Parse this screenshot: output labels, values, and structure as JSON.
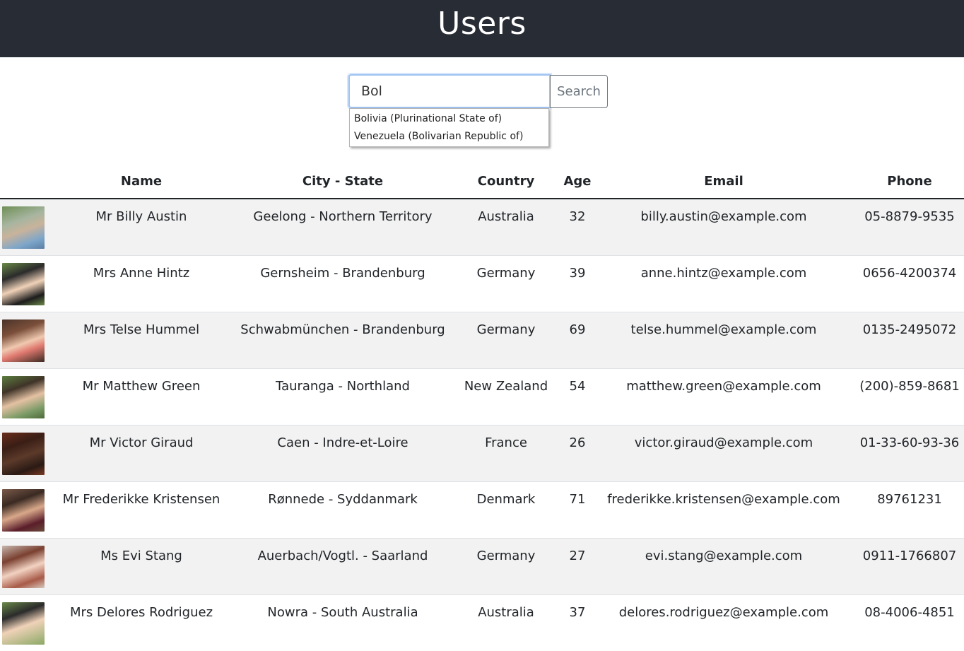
{
  "header": {
    "title": "Users"
  },
  "search": {
    "value": "Bol",
    "button_label": "Search",
    "suggestions": [
      "Bolivia (Plurinational State of)",
      "Venezuela (Bolivarian Republic of)"
    ]
  },
  "table": {
    "columns": [
      "",
      "Name",
      "City - State",
      "Country",
      "Age",
      "Email",
      "Phone"
    ],
    "rows": [
      {
        "avatar": "photo",
        "name": "Mr Billy Austin",
        "location": "Geelong - Northern Territory",
        "country": "Australia",
        "age": "32",
        "email": "billy.austin@example.com",
        "phone": "05-8879-9535"
      },
      {
        "avatar": "photo",
        "name": "Mrs Anne Hintz",
        "location": "Gernsheim - Brandenburg",
        "country": "Germany",
        "age": "39",
        "email": "anne.hintz@example.com",
        "phone": "0656-4200374"
      },
      {
        "avatar": "photo",
        "name": "Mrs Telse Hummel",
        "location": "Schwabmünchen - Brandenburg",
        "country": "Germany",
        "age": "69",
        "email": "telse.hummel@example.com",
        "phone": "0135-2495072"
      },
      {
        "avatar": "photo",
        "name": "Mr Matthew Green",
        "location": "Tauranga - Northland",
        "country": "New Zealand",
        "age": "54",
        "email": "matthew.green@example.com",
        "phone": "(200)-859-8681"
      },
      {
        "avatar": "photo",
        "name": "Mr Victor Giraud",
        "location": "Caen - Indre-et-Loire",
        "country": "France",
        "age": "26",
        "email": "victor.giraud@example.com",
        "phone": "01-33-60-93-36"
      },
      {
        "avatar": "photo",
        "name": "Mr Frederikke Kristensen",
        "location": "Rønnede - Syddanmark",
        "country": "Denmark",
        "age": "71",
        "email": "frederikke.kristensen@example.com",
        "phone": "89761231"
      },
      {
        "avatar": "photo",
        "name": "Ms Evi Stang",
        "location": "Auerbach/Vogtl. - Saarland",
        "country": "Germany",
        "age": "27",
        "email": "evi.stang@example.com",
        "phone": "0911-1766807"
      },
      {
        "avatar": "photo",
        "name": "Mrs Delores Rodriguez",
        "location": "Nowra - South Australia",
        "country": "Australia",
        "age": "37",
        "email": "delores.rodriguez@example.com",
        "phone": "08-4006-4851"
      }
    ]
  }
}
